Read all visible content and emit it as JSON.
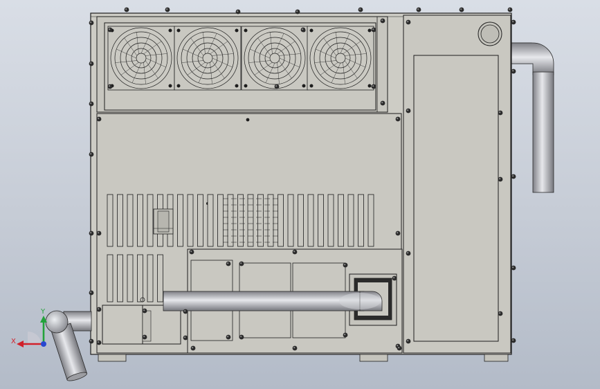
{
  "viewport": {
    "background_top": "#d9dee6",
    "background_bottom": "#b3bbc8"
  },
  "model": {
    "body_color": "#cdccc5",
    "panel_color": "#c9c8c1",
    "line_color": "#1d1d1d",
    "fan_count": 4,
    "pipe_color": "#a9aab0"
  },
  "triad": {
    "x_label": "X",
    "y_label": "Y",
    "x_color": "#d0202a",
    "y_color": "#22a23a",
    "z_color": "#2848d0"
  }
}
